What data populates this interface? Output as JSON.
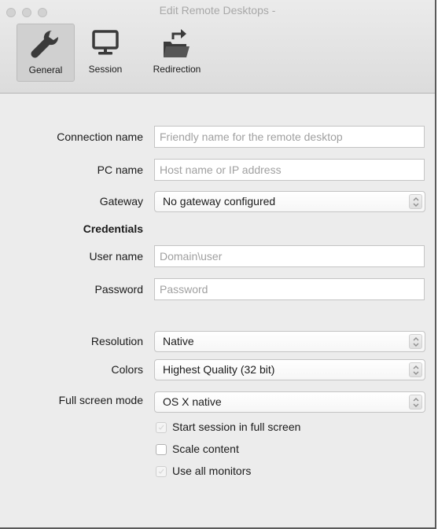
{
  "window": {
    "title": "Edit Remote Desktops -"
  },
  "toolbar": {
    "items": [
      {
        "label": "General",
        "icon": "wrench-icon",
        "selected": true
      },
      {
        "label": "Session",
        "icon": "monitor-icon",
        "selected": false
      },
      {
        "label": "Redirection",
        "icon": "folder-redirect-icon",
        "selected": false
      }
    ]
  },
  "form": {
    "connection_name": {
      "label": "Connection name",
      "value": "",
      "placeholder": "Friendly name for the remote desktop"
    },
    "pc_name": {
      "label": "PC name",
      "value": "",
      "placeholder": "Host name or IP address"
    },
    "gateway": {
      "label": "Gateway",
      "selected": "No gateway configured"
    },
    "credentials_heading": "Credentials",
    "user_name": {
      "label": "User name",
      "value": "",
      "placeholder": "Domain\\user"
    },
    "password": {
      "label": "Password",
      "value": "",
      "placeholder": "Password"
    },
    "resolution": {
      "label": "Resolution",
      "selected": "Native"
    },
    "colors": {
      "label": "Colors",
      "selected": "Highest Quality (32 bit)"
    },
    "full_screen_mode": {
      "label": "Full screen mode",
      "selected": "OS X native"
    },
    "checkboxes": [
      {
        "label": "Start session in full screen",
        "checked": false,
        "enabled": false
      },
      {
        "label": "Scale content",
        "checked": false,
        "enabled": true
      },
      {
        "label": "Use all monitors",
        "checked": false,
        "enabled": false
      }
    ]
  },
  "colors": {
    "window_bg": "#ececec",
    "placeholder": "#a0a0a0",
    "title_text": "#a8a8a8"
  }
}
